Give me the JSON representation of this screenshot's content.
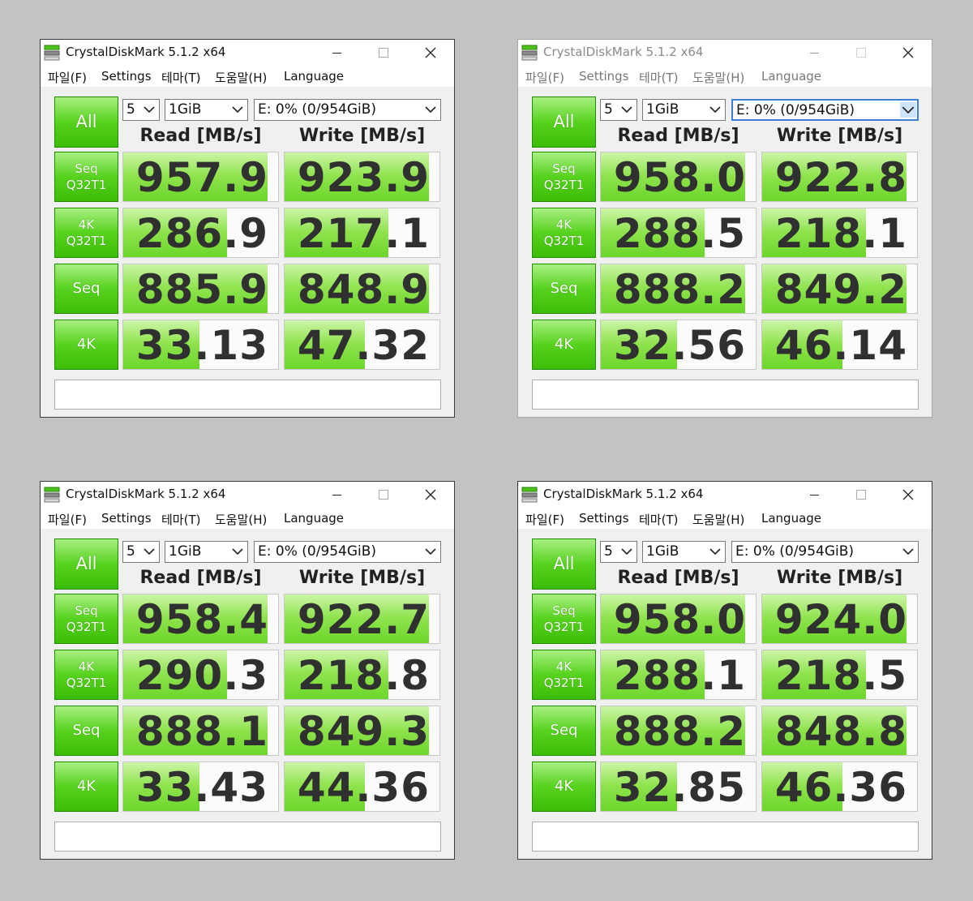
{
  "windows": [
    {
      "title": "CrystalDiskMark 5.1.2 x64",
      "active": true,
      "menu": [
        "파일(F)",
        "Settings",
        "테마(T)",
        "도움말(H)",
        "Language"
      ],
      "all_button": "All",
      "count": "5",
      "size": "1GiB",
      "drive": "E: 0% (0/954GiB)",
      "header_read": "Read [MB/s]",
      "header_write": "Write [MB/s]",
      "rows": [
        {
          "label1": "Seq",
          "label2": "Q32T1",
          "read": "957.9",
          "write": "923.9",
          "read_level": 0.93,
          "write_level": 0.93
        },
        {
          "label1": "4K",
          "label2": "Q32T1",
          "read": "286.9",
          "write": "217.1",
          "read_level": 0.67,
          "write_level": 0.67
        },
        {
          "label1": "Seq",
          "label2": "",
          "read": "885.9",
          "write": "848.9",
          "read_level": 0.93,
          "write_level": 0.93
        },
        {
          "label1": "4K",
          "label2": "",
          "read": "33.13",
          "write": "47.32",
          "read_level": 0.49,
          "write_level": 0.52
        }
      ],
      "comment": ""
    },
    {
      "title": "CrystalDiskMark 5.1.2 x64",
      "active": false,
      "menu": [
        "파일(F)",
        "Settings",
        "테마(T)",
        "도움말(H)",
        "Language"
      ],
      "all_button": "All",
      "count": "5",
      "size": "1GiB",
      "drive": "E: 0% (0/954GiB)",
      "header_read": "Read [MB/s]",
      "header_write": "Write [MB/s]",
      "rows": [
        {
          "label1": "Seq",
          "label2": "Q32T1",
          "read": "958.0",
          "write": "922.8",
          "read_level": 0.93,
          "write_level": 0.93
        },
        {
          "label1": "4K",
          "label2": "Q32T1",
          "read": "288.5",
          "write": "218.1",
          "read_level": 0.67,
          "write_level": 0.67
        },
        {
          "label1": "Seq",
          "label2": "",
          "read": "888.2",
          "write": "849.2",
          "read_level": 0.93,
          "write_level": 0.93
        },
        {
          "label1": "4K",
          "label2": "",
          "read": "32.56",
          "write": "46.14",
          "read_level": 0.49,
          "write_level": 0.52
        }
      ],
      "comment": ""
    },
    {
      "title": "CrystalDiskMark 5.1.2 x64",
      "active": true,
      "menu": [
        "파일(F)",
        "Settings",
        "테마(T)",
        "도움말(H)",
        "Language"
      ],
      "all_button": "All",
      "count": "5",
      "size": "1GiB",
      "drive": "E: 0% (0/954GiB)",
      "header_read": "Read [MB/s]",
      "header_write": "Write [MB/s]",
      "rows": [
        {
          "label1": "Seq",
          "label2": "Q32T1",
          "read": "958.4",
          "write": "922.7",
          "read_level": 0.93,
          "write_level": 0.93
        },
        {
          "label1": "4K",
          "label2": "Q32T1",
          "read": "290.3",
          "write": "218.8",
          "read_level": 0.67,
          "write_level": 0.67
        },
        {
          "label1": "Seq",
          "label2": "",
          "read": "888.1",
          "write": "849.3",
          "read_level": 0.93,
          "write_level": 0.93
        },
        {
          "label1": "4K",
          "label2": "",
          "read": "33.43",
          "write": "44.36",
          "read_level": 0.49,
          "write_level": 0.52
        }
      ],
      "comment": ""
    },
    {
      "title": "CrystalDiskMark 5.1.2 x64",
      "active": true,
      "menu": [
        "파일(F)",
        "Settings",
        "테마(T)",
        "도움말(H)",
        "Language"
      ],
      "all_button": "All",
      "count": "5",
      "size": "1GiB",
      "drive": "E: 0% (0/954GiB)",
      "header_read": "Read [MB/s]",
      "header_write": "Write [MB/s]",
      "rows": [
        {
          "label1": "Seq",
          "label2": "Q32T1",
          "read": "958.0",
          "write": "924.0",
          "read_level": 0.93,
          "write_level": 0.93
        },
        {
          "label1": "4K",
          "label2": "Q32T1",
          "read": "288.1",
          "write": "218.5",
          "read_level": 0.67,
          "write_level": 0.67
        },
        {
          "label1": "Seq",
          "label2": "",
          "read": "888.2",
          "write": "848.8",
          "read_level": 0.93,
          "write_level": 0.93
        },
        {
          "label1": "4K",
          "label2": "",
          "read": "32.85",
          "write": "46.36",
          "read_level": 0.49,
          "write_level": 0.52
        }
      ],
      "comment": ""
    }
  ],
  "icons": {
    "app": "crystaldiskmark-icon",
    "minimize": "minimize-icon",
    "maximize": "maximize-icon",
    "close": "close-icon",
    "dropdown": "chevron-down-icon"
  },
  "colors": {
    "desktop_background": "#c3c3c3",
    "button_green": "#57d21e",
    "bar_green": "#8fe34e",
    "focus_blue": "#3c7fd4"
  }
}
